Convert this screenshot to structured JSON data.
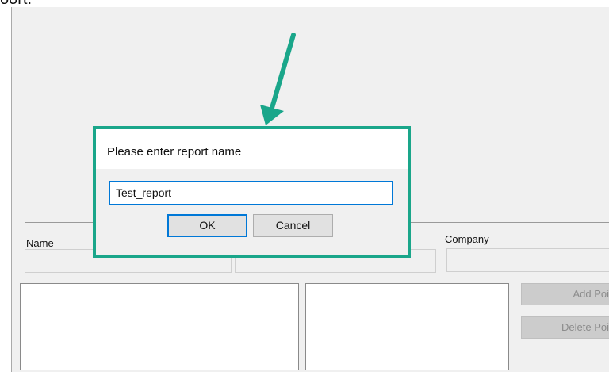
{
  "caption": {
    "text": "oort."
  },
  "form": {
    "name_label": "Name",
    "company_label": "Company"
  },
  "side_buttons": {
    "add_point": "Add Poi",
    "delete_point": "Delete Poi"
  },
  "dialog": {
    "title": "Please enter report name",
    "input_value": "Test_report",
    "ok_label": "OK",
    "cancel_label": "Cancel"
  },
  "colors": {
    "highlight": "#1aa68a",
    "focus_blue": "#0078d7",
    "window_bg": "#f0f0f0"
  }
}
